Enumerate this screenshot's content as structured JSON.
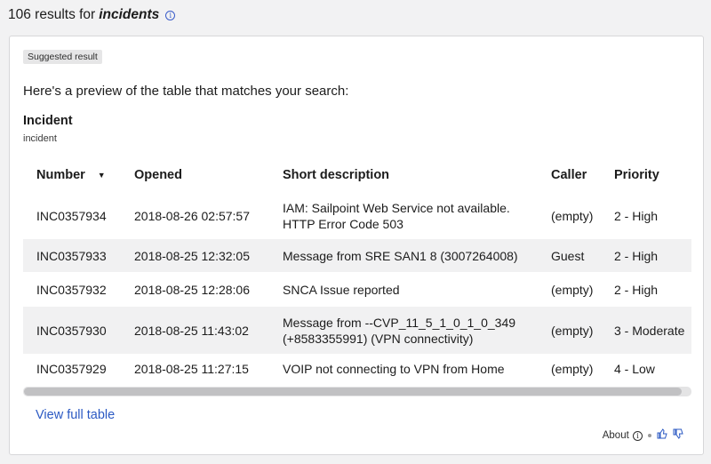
{
  "header": {
    "count_text": "106 results for",
    "query": "incidents"
  },
  "card": {
    "badge": "Suggested result",
    "intro": "Here's a preview of the table that matches your search:",
    "table_title": "Incident",
    "table_subtitle": "incident",
    "columns": [
      "Number",
      "Opened",
      "Short description",
      "Caller",
      "Priority"
    ],
    "rows": [
      {
        "number": "INC0357934",
        "opened": "2018-08-26 02:57:57",
        "desc_line1": "IAM: Sailpoint Web Service not available.",
        "desc_line2": "HTTP Error Code 503",
        "caller": "(empty)",
        "priority": "2 - High"
      },
      {
        "number": "INC0357933",
        "opened": "2018-08-25 12:32:05",
        "desc_line1": "Message from SRE SAN1 8 (3007264008)",
        "desc_line2": "",
        "caller": "Guest",
        "priority": "2 - High"
      },
      {
        "number": "INC0357932",
        "opened": "2018-08-25 12:28:06",
        "desc_line1": "SNCA Issue reported",
        "desc_line2": "",
        "caller": "(empty)",
        "priority": "2 - High"
      },
      {
        "number": "INC0357930",
        "opened": "2018-08-25 11:43:02",
        "desc_line1": "Message from --CVP_11_5_1_0_1_0_349",
        "desc_line2": "(+8583355991) (VPN connectivity)",
        "caller": "(empty)",
        "priority": "3 - Moderate"
      },
      {
        "number": "INC0357929",
        "opened": "2018-08-25 11:27:15",
        "desc_line1": "VOIP not connecting to VPN from Home",
        "desc_line2": "",
        "caller": "(empty)",
        "priority": "4 - Low"
      }
    ],
    "view_full_link": "View full table",
    "about_label": "About"
  },
  "icons": {
    "info": "info-circle-icon",
    "sort": "sort-down-icon",
    "thumbs_up": "thumbs-up-icon",
    "thumbs_down": "thumbs-down-icon"
  },
  "colors": {
    "link": "#2b59c3",
    "row_alt": "#f1f1f2"
  }
}
